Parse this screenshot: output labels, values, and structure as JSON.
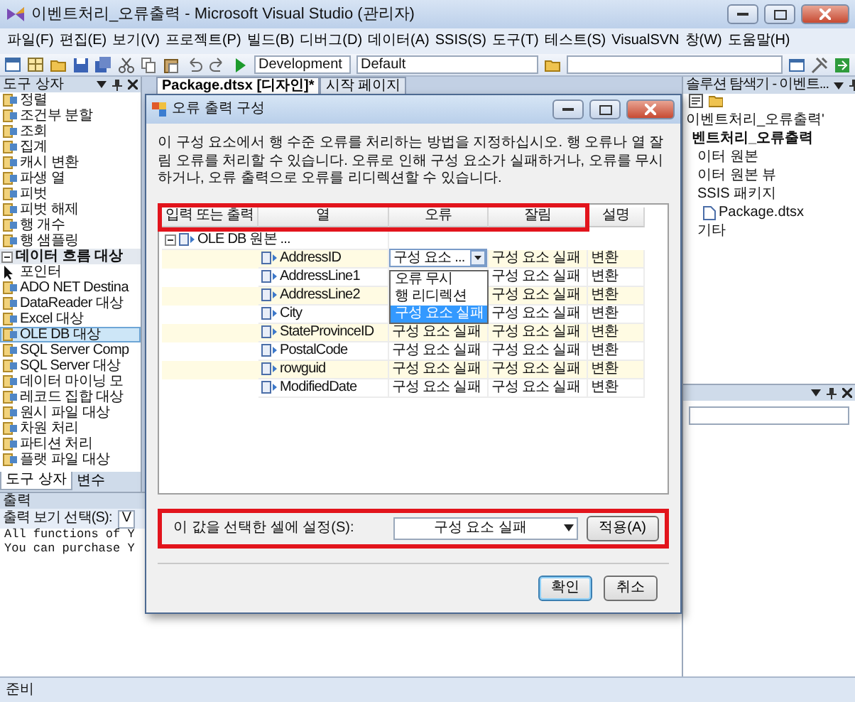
{
  "window": {
    "title": "이벤트처리_오류출력 - Microsoft Visual Studio (관리자)"
  },
  "menu": [
    "파일(F)",
    "편집(E)",
    "보기(V)",
    "프로젝트(P)",
    "빌드(B)",
    "디버그(D)",
    "데이터(A)",
    "SSIS(S)",
    "도구(T)",
    "테스트(S)",
    "VisualSVN",
    "창(W)",
    "도움말(H)"
  ],
  "toolbar": {
    "configuration": "Development",
    "platform": "Default"
  },
  "toolbox": {
    "title": "도구 상자",
    "items": [
      {
        "kind": "item",
        "label": "정렬",
        "selected": false
      },
      {
        "kind": "item",
        "label": "조건부 분할",
        "selected": false
      },
      {
        "kind": "item",
        "label": "조회",
        "selected": false
      },
      {
        "kind": "item",
        "label": "집계",
        "selected": false
      },
      {
        "kind": "item",
        "label": "캐시 변환",
        "selected": false
      },
      {
        "kind": "item",
        "label": "파생 열",
        "selected": false
      },
      {
        "kind": "item",
        "label": "피벗",
        "selected": false
      },
      {
        "kind": "item",
        "label": "피벗 해제",
        "selected": false
      },
      {
        "kind": "item",
        "label": "행 개수",
        "selected": false
      },
      {
        "kind": "item",
        "label": "행 샘플링",
        "selected": false
      },
      {
        "kind": "section",
        "label": "데이터 흐름 대상",
        "expanded": true
      },
      {
        "kind": "pointer",
        "label": "포인터",
        "selected": false
      },
      {
        "kind": "item",
        "label": "ADO NET Destina",
        "selected": false
      },
      {
        "kind": "item",
        "label": "DataReader 대상",
        "selected": false
      },
      {
        "kind": "item",
        "label": "Excel 대상",
        "selected": false
      },
      {
        "kind": "item",
        "label": "OLE DB 대상",
        "selected": true
      },
      {
        "kind": "item",
        "label": "SQL Server Comp",
        "selected": false
      },
      {
        "kind": "item",
        "label": "SQL Server 대상",
        "selected": false
      },
      {
        "kind": "item",
        "label": "데이터 마이닝 모",
        "selected": false
      },
      {
        "kind": "item",
        "label": "레코드 집합 대상",
        "selected": false
      },
      {
        "kind": "item",
        "label": "원시 파일 대상",
        "selected": false
      },
      {
        "kind": "item",
        "label": "차원 처리",
        "selected": false
      },
      {
        "kind": "item",
        "label": "파티션 처리",
        "selected": false
      },
      {
        "kind": "item",
        "label": "플랫 파일 대상",
        "selected": false
      }
    ],
    "tabs": [
      {
        "label": "도구 상자",
        "selected": true
      },
      {
        "label": "변수",
        "selected": false
      }
    ]
  },
  "document_tabs": [
    {
      "label": "Package.dtsx [디자인]*",
      "selected": true
    },
    {
      "label": "시작 페이지",
      "selected": false
    }
  ],
  "solution_explorer": {
    "title": "솔루션 탐색기 - 이벤트...",
    "tree": [
      {
        "label": "이벤트처리_오류출력'",
        "startup": false,
        "children": [
          {
            "label": "벤트처리_오류출력",
            "startup": true,
            "children": [
              {
                "label": "이터 원본",
                "startup": false
              },
              {
                "label": "이터 원본 뷰",
                "startup": false
              },
              {
                "label": "SSIS 패키지",
                "startup": false,
                "children": [
                  {
                    "kind": "file",
                    "label": "Package.dtsx",
                    "startup": false
                  }
                ]
              },
              {
                "label": "기타",
                "startup": false
              }
            ]
          }
        ]
      }
    ]
  },
  "output": {
    "title": "출력",
    "selector_label": "출력 보기 선택(S):",
    "selector_value": "V",
    "lines": [
      "All functions of Y",
      "You can purchase Y"
    ]
  },
  "status_bar": {
    "text": "준비"
  },
  "dialog": {
    "title": "오류 출력 구성",
    "description": "이 구성 요소에서 행 수준 오류를 처리하는 방법을 지정하십시오. 행 오류나 열 잘림 오류를 처리할 수 있습니다. 오류로 인해 구성 요소가 실패하거나, 오류를 무시하거나, 오류 출력으로 오류를 리디렉션할 수 있습니다.",
    "columns": [
      "입력 또는 출력",
      "열",
      "오류",
      "잘림",
      "설명"
    ],
    "group": {
      "label": "OLE DB 원본 ...",
      "expanded": true
    },
    "rows": [
      {
        "kind": "combo",
        "column": "AddressID",
        "error": "구성 요소 ...",
        "truncation": "구성 요소 실패",
        "description": "변환"
      },
      {
        "kind": "covered",
        "column": "AddressLine1",
        "truncation": "구성 요소 실패",
        "description": "변환"
      },
      {
        "kind": "covered",
        "column": "AddressLine2",
        "truncation": "구성 요소 실패",
        "description": "변환"
      },
      {
        "kind": "covered",
        "column": "City",
        "truncation": "구성 요소 실패",
        "description": "변환"
      },
      {
        "kind": "text",
        "column": "StateProvinceID",
        "error": "구성 요소 실패",
        "truncation": "구성 요소 실패",
        "description": "변환"
      },
      {
        "kind": "text",
        "column": "PostalCode",
        "error": "구성 요소 실패",
        "truncation": "구성 요소 실패",
        "description": "변환"
      },
      {
        "kind": "text",
        "column": "rowguid",
        "error": "구성 요소 실패",
        "truncation": "구성 요소 실패",
        "description": "변환"
      },
      {
        "kind": "text",
        "column": "ModifiedDate",
        "error": "구성 요소 실패",
        "truncation": "구성 요소 실패",
        "description": "변환"
      }
    ],
    "dropdown": {
      "options": [
        {
          "label": "오류 무시",
          "selected": false
        },
        {
          "label": "행 리디렉션",
          "selected": false
        },
        {
          "label": "구성 요소 실패",
          "selected": true
        }
      ]
    },
    "apply": {
      "label": "이 값을 선택한 셀에 설정(S):",
      "value": "구성 요소 실패",
      "button": "적용(A)"
    },
    "buttons": [
      {
        "label": "확인",
        "default": true
      },
      {
        "label": "취소",
        "default": false
      }
    ]
  }
}
